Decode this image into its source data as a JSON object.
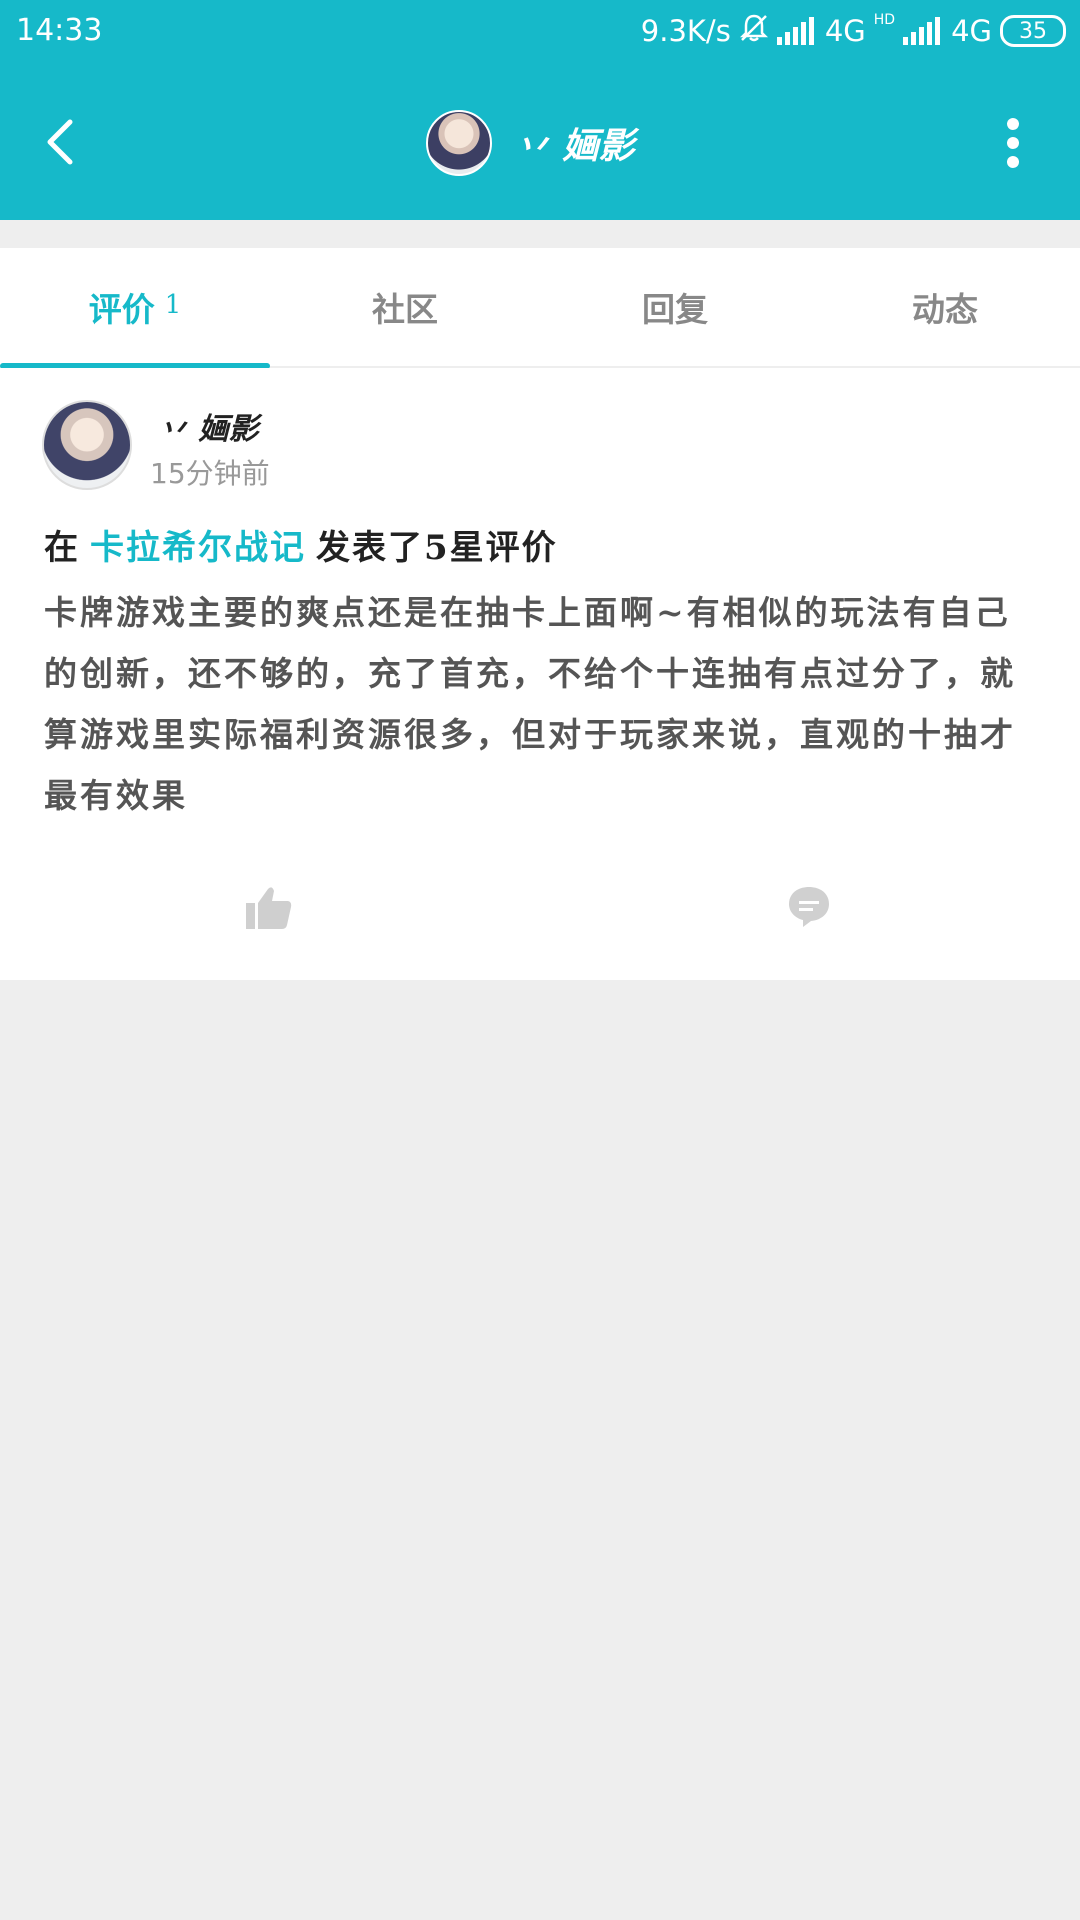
{
  "status_bar": {
    "time": "14:33",
    "speed": "9.3K/s",
    "network1": "4G",
    "network2": "4G",
    "hd": "HD",
    "battery": "35"
  },
  "header": {
    "title": "丷 婳影"
  },
  "tabs": [
    {
      "label": "评价",
      "count": "1"
    },
    {
      "label": "社区"
    },
    {
      "label": "回复"
    },
    {
      "label": "动态"
    }
  ],
  "post": {
    "username": "丷 婳影",
    "time": "15分钟前",
    "prefix": "在",
    "game": "卡拉希尔战记",
    "suffix": "发表了5星评价",
    "text": "卡牌游戏主要的爽点还是在抽卡上面啊~有相似的玩法有自己的创新，还不够的，充了首充，不给个十连抽有点过分了，就算游戏里实际福利资源很多，但对于玩家来说，直观的十抽才最有效果"
  },
  "colors": {
    "accent": "#16b9c9",
    "background": "#eeeeee"
  },
  "icons": {
    "back": "back-arrow-icon",
    "more": "more-vertical-icon",
    "like": "thumbs-up-icon",
    "comment": "comment-icon"
  }
}
